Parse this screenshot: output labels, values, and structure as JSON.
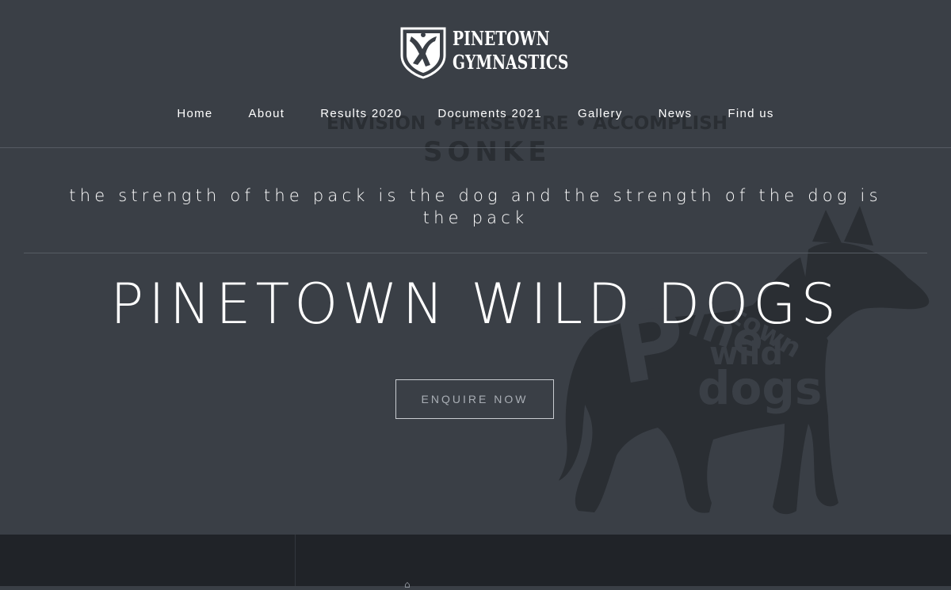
{
  "brand": {
    "line1": "PINETOWN",
    "line2": "GYMNASTICS"
  },
  "nav": {
    "items": [
      {
        "label": "Home"
      },
      {
        "label": "About"
      },
      {
        "label": "Results 2020"
      },
      {
        "label": "Documents 2021"
      },
      {
        "label": "Gallery"
      },
      {
        "label": "News"
      },
      {
        "label": "Find us"
      }
    ]
  },
  "background": {
    "motto": "ENVISION • PERSEVERE • ACCOMPLISH",
    "sonke": "SONKE",
    "dog_art_text": "Pinetown Wild Dogs"
  },
  "hero": {
    "tagline": "the strength of the pack is the dog and the strength of the dog is the pack",
    "headline": "PINETOWN WILD DOGS",
    "cta_label": "ENQUIRE NOW"
  },
  "colors": {
    "hero_bg": "#3a3f46",
    "footer_bg": "#202328",
    "text": "#ffffff",
    "watermark": "#2a2e33"
  }
}
